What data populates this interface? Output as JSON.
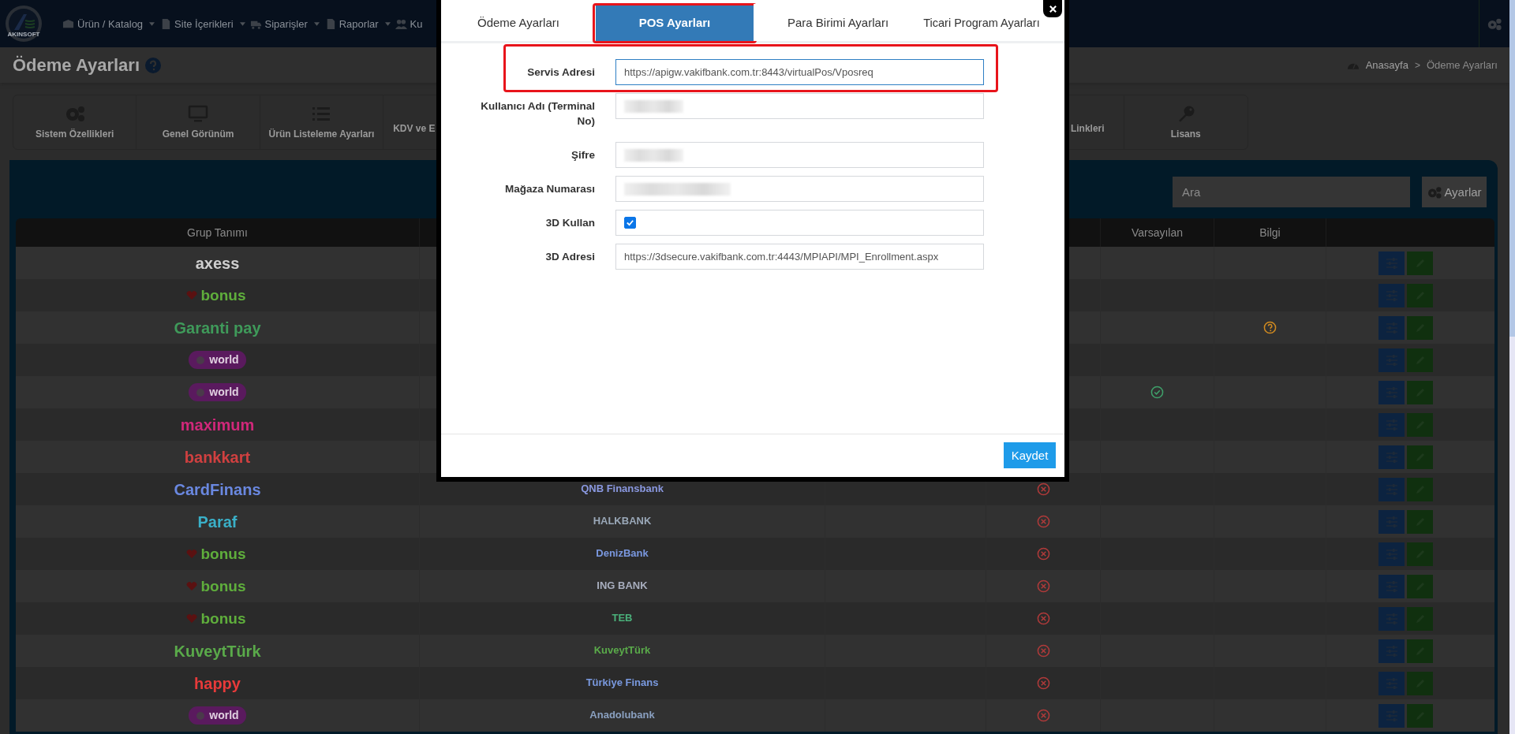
{
  "logo_text": "AKINSOFT",
  "nav": {
    "items": [
      "Ürün / Katalog",
      "Site İçerikleri",
      "Siparişler",
      "Raporlar",
      "Ku"
    ]
  },
  "page_title": "Ödeme Ayarları",
  "breadcrumb": {
    "items": [
      "Anasayfa",
      "Ödeme Ayarları"
    ],
    "separator": ">"
  },
  "tiles": [
    "Sistem Özellikleri",
    "Genel Görünüm",
    "Ürün Listeleme Ayarları",
    "KDV ve E",
    "Linkleri",
    "Lisans"
  ],
  "search": {
    "placeholder": "Ara"
  },
  "settings_button": "Ayarlar",
  "table": {
    "columns": [
      "Grup Tanımı",
      "Varsayılan",
      "Bilgi"
    ],
    "rows": [
      {
        "group": {
          "text": "axess",
          "kind": "wordmark",
          "color": "#d0d0d0"
        },
        "default": false,
        "info": false
      },
      {
        "group": {
          "text": "bonus",
          "kind": "bonus",
          "color": "#5fae3c"
        },
        "default": false,
        "info": false
      },
      {
        "group": {
          "text": "Garanti pay",
          "kind": "wordmark",
          "color": "#3f9a5a"
        },
        "default": false,
        "info": true
      },
      {
        "group": {
          "text": "world",
          "kind": "pill",
          "color": "#5a1a5e"
        },
        "default": false,
        "info": false
      },
      {
        "group": {
          "text": "world",
          "kind": "pill",
          "color": "#5a1a5e"
        },
        "default": true,
        "info": false
      },
      {
        "group": {
          "text": "maximum",
          "kind": "wordmark",
          "color": "#d0287a"
        },
        "default": false,
        "info": false
      },
      {
        "group": {
          "text": "bankkart",
          "kind": "wordmark",
          "color": "#d04040"
        },
        "default": false,
        "info": false
      },
      {
        "group": {
          "text": "CardFinans",
          "kind": "wordmark",
          "color": "#6a88e0"
        },
        "bank": {
          "text": "QNB Finansbank",
          "color": "#8a98e0"
        },
        "active": false,
        "default": false,
        "info": false
      },
      {
        "group": {
          "text": "Paraf",
          "kind": "wordmark",
          "color": "#3ab0c8"
        },
        "bank": {
          "text": "HALKBANK",
          "color": "#9aa8b8"
        },
        "active": false,
        "default": false,
        "info": false
      },
      {
        "group": {
          "text": "bonus",
          "kind": "bonus",
          "color": "#5fae3c"
        },
        "bank": {
          "text": "DenizBank",
          "color": "#7a98e0"
        },
        "active": false,
        "default": false,
        "info": false
      },
      {
        "group": {
          "text": "bonus",
          "kind": "bonus",
          "color": "#5fae3c"
        },
        "bank": {
          "text": "ING BANK",
          "color": "#a8aebe"
        },
        "active": false,
        "default": false,
        "info": false
      },
      {
        "group": {
          "text": "bonus",
          "kind": "bonus",
          "color": "#5fae3c"
        },
        "bank": {
          "text": "TEB",
          "color": "#4ab07a"
        },
        "active": false,
        "default": false,
        "info": false
      },
      {
        "group": {
          "text": "KuveytTürk",
          "kind": "wordmark",
          "color": "#5aaa4a"
        },
        "bank": {
          "text": "KuveytTürk",
          "color": "#5aaa4a"
        },
        "active": false,
        "default": false,
        "info": false
      },
      {
        "group": {
          "text": "happy",
          "kind": "wordmark",
          "color": "#e83a3a"
        },
        "bank": {
          "text": "Türkiye Finans",
          "color": "#7a9ae0"
        },
        "active": false,
        "default": false,
        "info": false
      },
      {
        "group": {
          "text": "world",
          "kind": "pill",
          "color": "#5a1a5e"
        },
        "bank": {
          "text": "Anadolubank",
          "color": "#8aa0c0"
        },
        "active": false,
        "default": false,
        "info": false
      }
    ]
  },
  "dialog": {
    "tabs": [
      {
        "label": "Ödeme Ayarları",
        "selected": false,
        "highlighted": false
      },
      {
        "label": "POS Ayarları",
        "selected": true,
        "highlighted": true
      },
      {
        "label": "Para Birimi Ayarları",
        "selected": false,
        "highlighted": false
      },
      {
        "label": "Ticari Program Ayarları",
        "selected": false,
        "highlighted": false
      }
    ],
    "fields": [
      {
        "label": "Servis Adresi",
        "kind": "text",
        "value": "https://apigw.vakifbank.com.tr:8443/virtualPos/Vposreq",
        "focused": true,
        "highlighted": true
      },
      {
        "label": "Kullanıcı Adı (Terminal No)",
        "kind": "redacted",
        "highlighted": false
      },
      {
        "label": "Şifre",
        "kind": "redacted",
        "highlighted": false
      },
      {
        "label": "Mağaza Numarası",
        "kind": "redacted",
        "highlighted": false
      },
      {
        "label": "3D Kullan",
        "kind": "checkbox",
        "checked": true,
        "highlighted": false
      },
      {
        "label": "3D Adresi",
        "kind": "text",
        "value": "https://3dsecure.vakifbank.com.tr:4443/MPIAPI/MPI_Enrollment.aspx",
        "focused": false,
        "highlighted": false
      }
    ],
    "save_button": "Kaydet"
  }
}
